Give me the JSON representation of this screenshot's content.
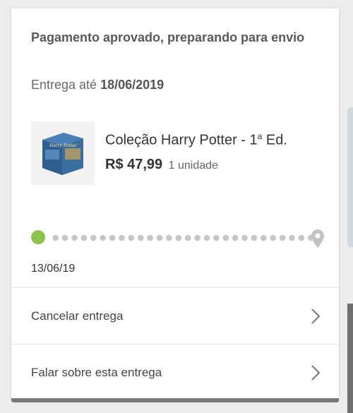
{
  "order": {
    "status": "Pagamento aprovado, preparando para envio",
    "delivery_prefix": "Entrega até",
    "delivery_date": "18/06/2019"
  },
  "product": {
    "title": "Coleção Harry Potter - 1",
    "title_super": "a",
    "title_suffix": " Ed.",
    "price": "R$ 47,99",
    "quantity": "1 unidade",
    "image_label": "Harry Potter"
  },
  "tracking": {
    "start_date": "13/06/19",
    "start_color": "#8bc34a",
    "dot_color": "#c6c6c6",
    "end_icon": "location-pin-icon"
  },
  "actions": [
    {
      "label": "Cancelar entrega"
    },
    {
      "label": "Falar sobre esta entrega"
    }
  ]
}
